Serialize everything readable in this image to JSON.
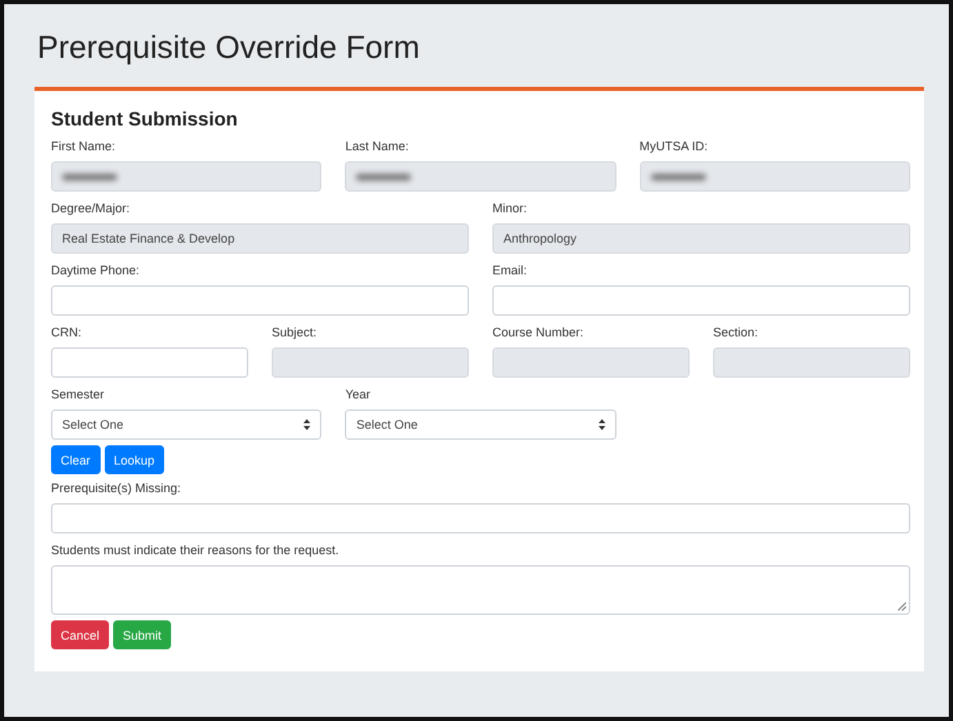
{
  "title": "Prerequisite Override Form",
  "section": {
    "title": "Student Submission"
  },
  "rows": [
    {
      "kind": "fields",
      "fields": [
        {
          "label": "First Name:",
          "kind": "input",
          "disabled": true,
          "redacted": true
        },
        {
          "label": "Last Name:",
          "kind": "input",
          "disabled": true,
          "redacted": true
        },
        {
          "label": "MyUTSA ID:",
          "kind": "input",
          "disabled": true,
          "redacted": true
        }
      ]
    },
    {
      "kind": "fields",
      "fields": [
        {
          "label": "Degree/Major:",
          "kind": "input",
          "disabled": true,
          "value": "Real Estate Finance & Develop"
        },
        {
          "label": "Minor:",
          "kind": "input",
          "disabled": true,
          "value": "Anthropology"
        }
      ]
    },
    {
      "kind": "fields",
      "fields": [
        {
          "label": "Daytime Phone:",
          "kind": "input",
          "disabled": false
        },
        {
          "label": "Email:",
          "kind": "input",
          "disabled": false
        }
      ]
    },
    {
      "kind": "fields",
      "fields": [
        {
          "label": "CRN:",
          "kind": "input",
          "disabled": false
        },
        {
          "label": "Subject:",
          "kind": "input",
          "disabled": true
        },
        {
          "label": "Course Number:",
          "kind": "input",
          "disabled": true
        },
        {
          "label": "Section:",
          "kind": "input",
          "disabled": true
        }
      ]
    },
    {
      "kind": "fields",
      "fields": [
        {
          "label": "Semester",
          "kind": "select",
          "value": "Select One"
        },
        {
          "label": "Year",
          "kind": "select",
          "value": "Select One"
        }
      ]
    },
    {
      "kind": "buttons",
      "buttons": [
        {
          "label": "Clear",
          "color": "#007bff"
        },
        {
          "label": "Lookup",
          "color": "#007bff"
        }
      ]
    },
    {
      "kind": "fields",
      "fields": [
        {
          "label": "Prerequisite(s) Missing:",
          "kind": "input",
          "disabled": false
        }
      ]
    },
    {
      "kind": "fields",
      "fields": [
        {
          "label": "Students must indicate their reasons for the request.",
          "kind": "textarea"
        }
      ]
    },
    {
      "kind": "buttons",
      "buttons": [
        {
          "label": "Cancel",
          "color": "#dc3545"
        },
        {
          "label": "Submit",
          "color": "#28a745"
        }
      ]
    }
  ]
}
